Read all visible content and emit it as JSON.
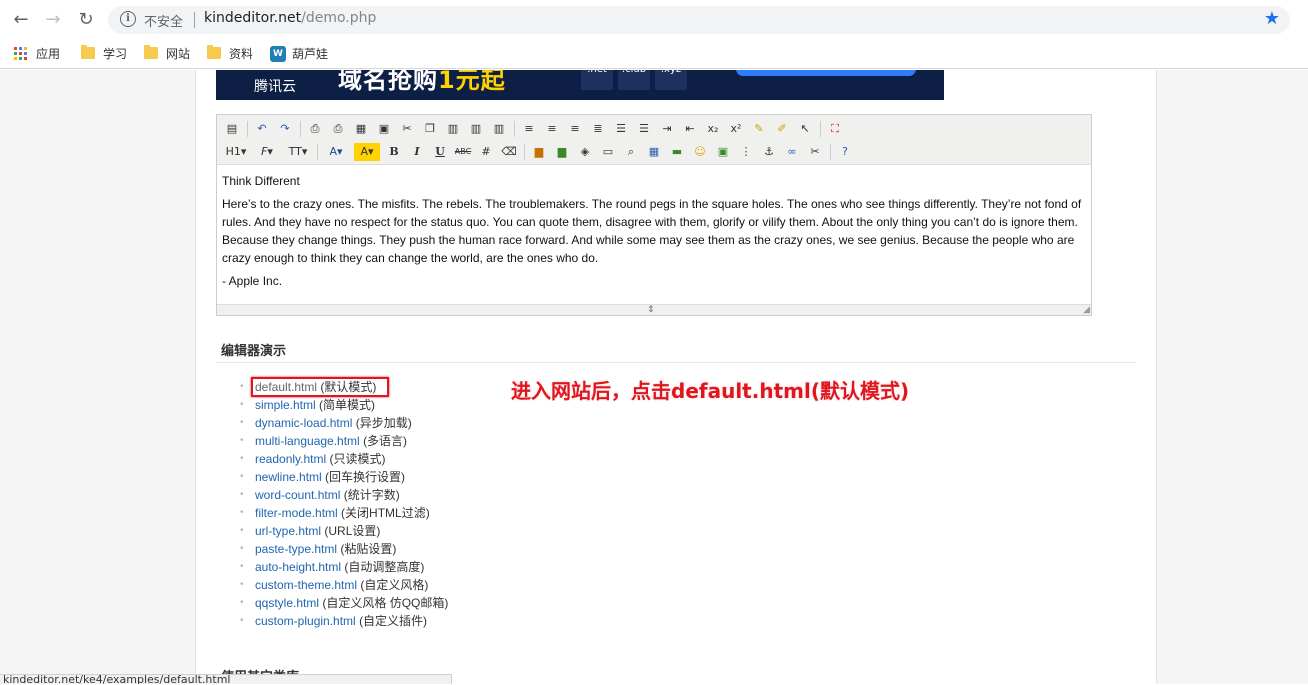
{
  "browser": {
    "back_icon": "arrow-left-icon",
    "forward_icon": "arrow-right-icon",
    "reload_icon": "reload-icon",
    "security_label": "不安全",
    "url_host": "kindeditor.net",
    "url_path": "/demo.php",
    "star_icon": "star-icon",
    "status_url": "kindeditor.net/ke4/examples/default.html"
  },
  "bookmarks": [
    {
      "label": "应用",
      "icon": "apps-icon"
    },
    {
      "label": "学习",
      "icon": "folder-icon"
    },
    {
      "label": "网站",
      "icon": "folder-icon"
    },
    {
      "label": "资料",
      "icon": "folder-icon"
    },
    {
      "label": "葫芦娃",
      "icon": "site-icon"
    }
  ],
  "ad": {
    "logo": "腾讯云",
    "headline_a": "域名抢购",
    "headline_b": "1元起",
    "tlds": [
      ".net",
      ".club",
      ".xyz"
    ]
  },
  "editor": {
    "toolbar_row2_labels": {
      "heading": "H1",
      "font": "F",
      "size": "TT"
    },
    "content": {
      "title": "Think Different",
      "body": "Here’s to the crazy ones. The misfits. The rebels. The troublemakers. The round pegs in the square holes. The ones who see things differently. They’re not fond of rules. And they have no respect for the status quo. You can quote them, disagree with them, glorify or vilify them. About the only thing you can’t do is ignore them. Because they change things. They push the human race forward. And while some may see them as the crazy ones, we see genius. Because the people who are crazy enough to think they can change the world, are the ones who do.",
      "signature": "- Apple Inc."
    }
  },
  "section": {
    "title": "编辑器演示",
    "next_title": "使用其它类库"
  },
  "demos": [
    {
      "link": "default.html",
      "desc": "(默认模式)"
    },
    {
      "link": "simple.html",
      "desc": "(简单模式)"
    },
    {
      "link": "dynamic-load.html",
      "desc": "(异步加载)"
    },
    {
      "link": "multi-language.html",
      "desc": "(多语言)"
    },
    {
      "link": "readonly.html",
      "desc": "(只读模式)"
    },
    {
      "link": "newline.html",
      "desc": "(回车换行设置)"
    },
    {
      "link": "word-count.html",
      "desc": "(统计字数)"
    },
    {
      "link": "filter-mode.html",
      "desc": "(关闭HTML过滤)"
    },
    {
      "link": "url-type.html",
      "desc": "(URL设置)"
    },
    {
      "link": "paste-type.html",
      "desc": "(粘贴设置)"
    },
    {
      "link": "auto-height.html",
      "desc": "(自动调整高度)"
    },
    {
      "link": "custom-theme.html",
      "desc": "(自定义风格)"
    },
    {
      "link": "qqstyle.html",
      "desc": "(自定义风格 仿QQ邮箱)"
    },
    {
      "link": "custom-plugin.html",
      "desc": "(自定义插件)"
    }
  ],
  "annotation": "进入网站后，点击default.html(默认模式)",
  "colors": {
    "annotation_red": "#e0161e",
    "link_blue": "#2165b0",
    "chrome_blue": "#1a73e8"
  }
}
